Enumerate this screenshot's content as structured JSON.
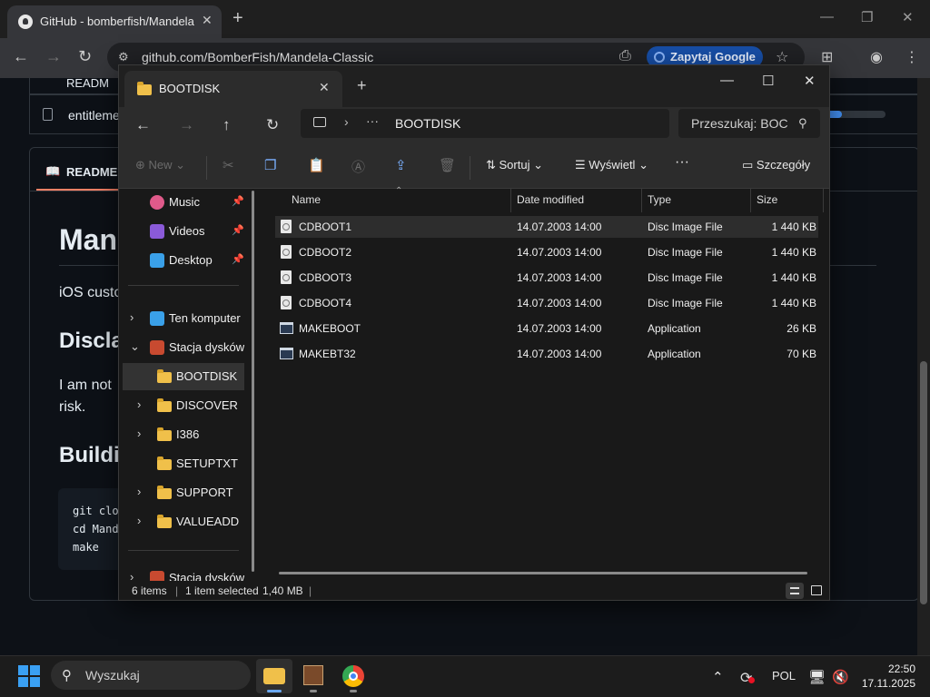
{
  "browser": {
    "tab_title": "GitHub - bomberfish/Mandela-",
    "url": "github.com/BomberFish/Mandela-Classic",
    "ask_google": "Zapytaj Google"
  },
  "github": {
    "list_item_1": "READM",
    "list_item_2": "entitleme",
    "readme_tab": "README",
    "heading": "Man",
    "intro": "iOS custo",
    "disclaimer_heading": "Discla",
    "disclaimer_line1": "I am not",
    "disclaimer_line2": "risk.",
    "building_heading": "Buildi",
    "code_lines": [
      "git clo",
      "cd Mand",
      "make"
    ]
  },
  "explorer": {
    "tab_title": "BOOTDISK",
    "breadcrumb": "BOOTDISK",
    "search_placeholder": "Przeszukaj: BOC",
    "commands": {
      "new": "New",
      "sort": "Sortuj",
      "view": "Wyświetl",
      "more": "···",
      "details": "Szczegóły"
    },
    "nav": [
      {
        "label": "Music",
        "pinned": true,
        "icon": "music-icon",
        "color": "#e05a8a"
      },
      {
        "label": "Videos",
        "pinned": true,
        "icon": "videos-icon",
        "color": "#8a5ad8"
      },
      {
        "label": "Desktop",
        "pinned": true,
        "icon": "desktop-icon",
        "color": "#3aa0e8"
      },
      {
        "label": "Ten komputer",
        "icon": "pc-icon",
        "color": "#3aa0e8"
      },
      {
        "label": "Stacja dysków D",
        "icon": "cd-drive-icon",
        "color": "#c84a30"
      },
      {
        "label": "BOOTDISK",
        "selected": true
      },
      {
        "label": "DISCOVER"
      },
      {
        "label": "I386"
      },
      {
        "label": "SETUPTXT"
      },
      {
        "label": "SUPPORT"
      },
      {
        "label": "VALUEADD"
      },
      {
        "label": "Stacja dysków D"
      }
    ],
    "columns": [
      "Name",
      "Date modified",
      "Type",
      "Size"
    ],
    "files": [
      {
        "name": "CDBOOT1",
        "date": "14.07.2003 14:00",
        "type": "Disc Image File",
        "size": "1 440 KB",
        "icon": "disc-image-icon"
      },
      {
        "name": "CDBOOT2",
        "date": "14.07.2003 14:00",
        "type": "Disc Image File",
        "size": "1 440 KB",
        "icon": "disc-image-icon"
      },
      {
        "name": "CDBOOT3",
        "date": "14.07.2003 14:00",
        "type": "Disc Image File",
        "size": "1 440 KB",
        "icon": "disc-image-icon"
      },
      {
        "name": "CDBOOT4",
        "date": "14.07.2003 14:00",
        "type": "Disc Image File",
        "size": "1 440 KB",
        "icon": "disc-image-icon"
      },
      {
        "name": "MAKEBOOT",
        "date": "14.07.2003 14:00",
        "type": "Application",
        "size": "26 KB",
        "icon": "application-icon"
      },
      {
        "name": "MAKEBT32",
        "date": "14.07.2003 14:00",
        "type": "Application",
        "size": "70 KB",
        "icon": "application-icon"
      }
    ],
    "status": {
      "count": "6 items",
      "selected": "1 item selected",
      "size": "1,40 MB"
    }
  },
  "taskbar": {
    "search_placeholder": "Wyszukaj",
    "language": "POL",
    "time": "22:50",
    "date": "17.11.2025"
  }
}
